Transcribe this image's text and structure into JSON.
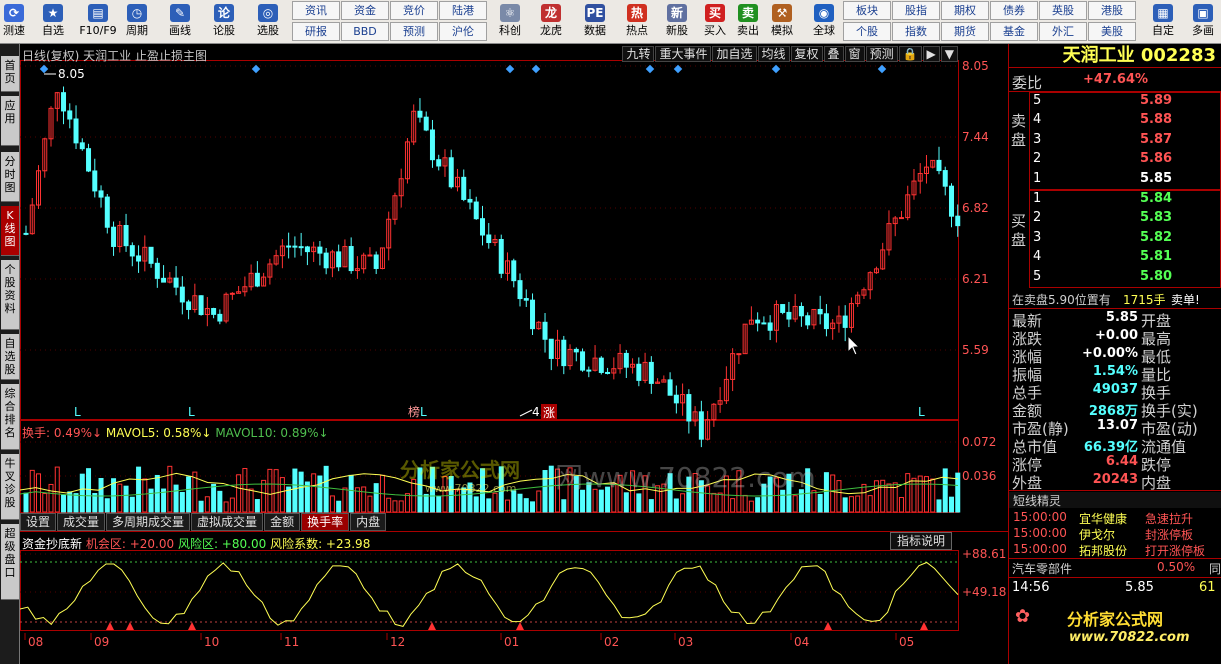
{
  "toolbar": {
    "buttons": [
      {
        "label": "测速",
        "icon": "speed-icon",
        "color": "#3a6ad8"
      },
      {
        "label": "自选",
        "icon": "star-icon",
        "color": "#2d5fb8"
      },
      {
        "label": "F10/F9",
        "icon": "document-icon",
        "color": "#2d5fb8"
      },
      {
        "label": "周期",
        "icon": "clock-icon",
        "color": "#2d5fb8"
      },
      {
        "label": "画线",
        "icon": "pencil-icon",
        "color": "#2d5fb8"
      },
      {
        "label": "论股",
        "icon": "discuss-icon",
        "color": "#2d5fb8"
      },
      {
        "label": "选股",
        "icon": "chart-search-icon",
        "color": "#2d5fb8"
      },
      {
        "label": "科创",
        "icon": "tech-icon",
        "color": "#7a8aa8"
      },
      {
        "label": "龙虎",
        "icon": "dragon-icon",
        "color": "#c03030"
      },
      {
        "label": "数据",
        "icon": "pe-icon",
        "color": "#3050a0"
      },
      {
        "label": "热点",
        "icon": "hot-icon",
        "color": "#d03020"
      },
      {
        "label": "新股",
        "icon": "new-stock-icon",
        "color": "#6070a0"
      },
      {
        "label": "买入",
        "icon": "buy-icon",
        "color": "#d02020"
      },
      {
        "label": "卖出",
        "icon": "sell-icon",
        "color": "#209020"
      },
      {
        "label": "模拟",
        "icon": "hammer-icon",
        "color": "#b06020"
      },
      {
        "label": "全球",
        "icon": "globe-icon",
        "color": "#2060c0"
      },
      {
        "label": "自定",
        "icon": "custom-icon",
        "color": "#2d5fb8"
      },
      {
        "label": "多画",
        "icon": "multi-icon",
        "color": "#2d5fb8"
      }
    ],
    "cells": [
      [
        "资讯",
        "资金",
        "竞价",
        "陆港"
      ],
      [
        "研报",
        "BBD",
        "预测",
        "沪伦"
      ],
      [
        "板块",
        "股指",
        "期权",
        "债券",
        "英股",
        "港股"
      ],
      [
        "个股",
        "指数",
        "期货",
        "基金",
        "外汇",
        "美股"
      ]
    ]
  },
  "leftnav": [
    {
      "label": "首页",
      "active": false
    },
    {
      "label": "应用",
      "active": false
    },
    {
      "label": "分时图",
      "active": false
    },
    {
      "label": "K线图",
      "active": true
    },
    {
      "label": "个股资料",
      "active": false
    },
    {
      "label": "自选股",
      "active": false
    },
    {
      "label": "综合排名",
      "active": false
    },
    {
      "label": "牛叉诊股",
      "active": false
    },
    {
      "label": "超级盘口",
      "active": false
    }
  ],
  "kline": {
    "title": "日线(复权)  天润工业  止盈止损主图",
    "tools": [
      "九转",
      "重大事件",
      "加自选",
      "均线",
      "复权",
      "叠",
      "窗",
      "预测"
    ],
    "high_label": "8.05",
    "low_label": "4.",
    "zhang_label": "涨",
    "bang_label": "榜",
    "l_label": "L",
    "price_ticks": [
      "8.05",
      "7.44",
      "6.82",
      "6.21",
      "5.59"
    ]
  },
  "volume": {
    "legend_huanshou": "换手: 0.49%",
    "legend_mavol5": "MAVOL5: 0.58%",
    "legend_mavol10": "MAVOL10: 0.89%",
    "ticks": [
      "0.072",
      "0.036"
    ]
  },
  "tabs": [
    "设置",
    "成交量",
    "多周期成交量",
    "虚拟成交量",
    "金额",
    "换手率",
    "内盘"
  ],
  "active_tab": "换手率",
  "indicator": {
    "name": "资金抄底新",
    "jihui": "机会区: +20.00",
    "fengxian": "风险区: +80.00",
    "xishu": "风险系数: +23.98",
    "button": "指标说明",
    "ticks": [
      "+88.61",
      "+49.18"
    ]
  },
  "months": [
    "08",
    "09",
    "10",
    "11",
    "12",
    "01",
    "02",
    "03",
    "04",
    "05"
  ],
  "watermark": {
    "site": "分析家公式网",
    "url": "www.70822.com",
    "text": "网www.70822.com"
  },
  "quote": {
    "title": "天润工业 002283",
    "weibi_label": "委比",
    "weibi_value": "+47.64%",
    "sell_label": "卖盘",
    "buy_label": "买盘",
    "sell": [
      [
        "5",
        "5.89"
      ],
      [
        "4",
        "5.88"
      ],
      [
        "3",
        "5.87"
      ],
      [
        "2",
        "5.86"
      ],
      [
        "1",
        "5.85"
      ]
    ],
    "buy": [
      [
        "1",
        "5.84"
      ],
      [
        "2",
        "5.83"
      ],
      [
        "3",
        "5.82"
      ],
      [
        "4",
        "5.81"
      ],
      [
        "5",
        "5.80"
      ]
    ],
    "notice_a": "在卖盘5.90位置有",
    "notice_b": "1715手",
    "notice_c": "卖单!",
    "stats": [
      [
        "最新",
        "5.85",
        "开盘"
      ],
      [
        "涨跌",
        "+0.00",
        "最高"
      ],
      [
        "涨幅",
        "+0.00%",
        "最低"
      ],
      [
        "振幅",
        "1.54%",
        "量比"
      ],
      [
        "总手",
        "49037",
        "换手"
      ],
      [
        "金额",
        "2868万",
        "换手(实)"
      ],
      [
        "市盈(静)",
        "13.07",
        "市盈(动)"
      ],
      [
        "总市值",
        "66.39亿",
        "流通值"
      ],
      [
        "涨停",
        "6.44",
        "跌停"
      ],
      [
        "外盘",
        "20243",
        "内盘"
      ]
    ],
    "elves_title": "短线精灵",
    "elves": [
      [
        "15:00:00",
        "宜华健康",
        "急速拉升"
      ],
      [
        "15:00:00",
        "伊戈尔",
        "封涨停板"
      ],
      [
        "15:00:00",
        "拓邦股份",
        "打开涨停板"
      ]
    ],
    "sector_name": "汽车零部件",
    "sector_pct": "0.50%",
    "sector_extra": "同",
    "trade_time": "14:56",
    "trade_price": "5.85",
    "trade_vol": "61",
    "bottom_logo": "分析家公式网",
    "bottom_url": "www.70822.com"
  }
}
